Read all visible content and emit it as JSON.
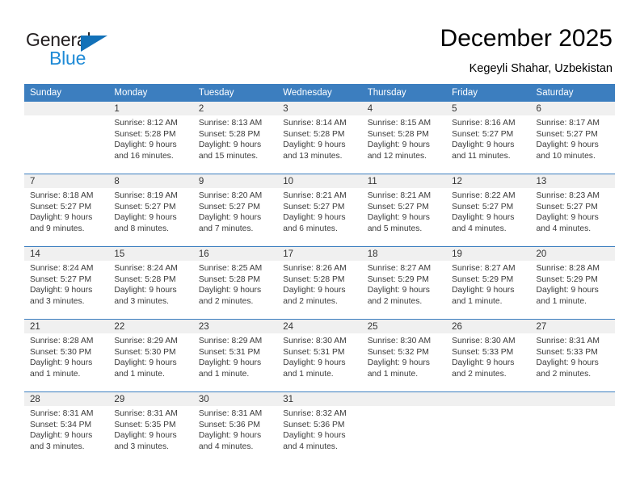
{
  "brand": {
    "name_top": "General",
    "name_bottom": "Blue",
    "triangle_color": "#1271b8",
    "blue_color": "#1e8ad6"
  },
  "header": {
    "title": "December 2025",
    "subtitle": "Kegeyli Shahar, Uzbekistan"
  },
  "theme": {
    "header_blue": "#3c7ebf",
    "daynum_band": "#f0f0f0",
    "text": "#3a3a3a"
  },
  "weekdays": [
    "Sunday",
    "Monday",
    "Tuesday",
    "Wednesday",
    "Thursday",
    "Friday",
    "Saturday"
  ],
  "weeks": [
    [
      {
        "day": "",
        "lines": []
      },
      {
        "day": "1",
        "lines": [
          "Sunrise: 8:12 AM",
          "Sunset: 5:28 PM",
          "Daylight: 9 hours",
          "and 16 minutes."
        ]
      },
      {
        "day": "2",
        "lines": [
          "Sunrise: 8:13 AM",
          "Sunset: 5:28 PM",
          "Daylight: 9 hours",
          "and 15 minutes."
        ]
      },
      {
        "day": "3",
        "lines": [
          "Sunrise: 8:14 AM",
          "Sunset: 5:28 PM",
          "Daylight: 9 hours",
          "and 13 minutes."
        ]
      },
      {
        "day": "4",
        "lines": [
          "Sunrise: 8:15 AM",
          "Sunset: 5:28 PM",
          "Daylight: 9 hours",
          "and 12 minutes."
        ]
      },
      {
        "day": "5",
        "lines": [
          "Sunrise: 8:16 AM",
          "Sunset: 5:27 PM",
          "Daylight: 9 hours",
          "and 11 minutes."
        ]
      },
      {
        "day": "6",
        "lines": [
          "Sunrise: 8:17 AM",
          "Sunset: 5:27 PM",
          "Daylight: 9 hours",
          "and 10 minutes."
        ]
      }
    ],
    [
      {
        "day": "7",
        "lines": [
          "Sunrise: 8:18 AM",
          "Sunset: 5:27 PM",
          "Daylight: 9 hours",
          "and 9 minutes."
        ]
      },
      {
        "day": "8",
        "lines": [
          "Sunrise: 8:19 AM",
          "Sunset: 5:27 PM",
          "Daylight: 9 hours",
          "and 8 minutes."
        ]
      },
      {
        "day": "9",
        "lines": [
          "Sunrise: 8:20 AM",
          "Sunset: 5:27 PM",
          "Daylight: 9 hours",
          "and 7 minutes."
        ]
      },
      {
        "day": "10",
        "lines": [
          "Sunrise: 8:21 AM",
          "Sunset: 5:27 PM",
          "Daylight: 9 hours",
          "and 6 minutes."
        ]
      },
      {
        "day": "11",
        "lines": [
          "Sunrise: 8:21 AM",
          "Sunset: 5:27 PM",
          "Daylight: 9 hours",
          "and 5 minutes."
        ]
      },
      {
        "day": "12",
        "lines": [
          "Sunrise: 8:22 AM",
          "Sunset: 5:27 PM",
          "Daylight: 9 hours",
          "and 4 minutes."
        ]
      },
      {
        "day": "13",
        "lines": [
          "Sunrise: 8:23 AM",
          "Sunset: 5:27 PM",
          "Daylight: 9 hours",
          "and 4 minutes."
        ]
      }
    ],
    [
      {
        "day": "14",
        "lines": [
          "Sunrise: 8:24 AM",
          "Sunset: 5:27 PM",
          "Daylight: 9 hours",
          "and 3 minutes."
        ]
      },
      {
        "day": "15",
        "lines": [
          "Sunrise: 8:24 AM",
          "Sunset: 5:28 PM",
          "Daylight: 9 hours",
          "and 3 minutes."
        ]
      },
      {
        "day": "16",
        "lines": [
          "Sunrise: 8:25 AM",
          "Sunset: 5:28 PM",
          "Daylight: 9 hours",
          "and 2 minutes."
        ]
      },
      {
        "day": "17",
        "lines": [
          "Sunrise: 8:26 AM",
          "Sunset: 5:28 PM",
          "Daylight: 9 hours",
          "and 2 minutes."
        ]
      },
      {
        "day": "18",
        "lines": [
          "Sunrise: 8:27 AM",
          "Sunset: 5:29 PM",
          "Daylight: 9 hours",
          "and 2 minutes."
        ]
      },
      {
        "day": "19",
        "lines": [
          "Sunrise: 8:27 AM",
          "Sunset: 5:29 PM",
          "Daylight: 9 hours",
          "and 1 minute."
        ]
      },
      {
        "day": "20",
        "lines": [
          "Sunrise: 8:28 AM",
          "Sunset: 5:29 PM",
          "Daylight: 9 hours",
          "and 1 minute."
        ]
      }
    ],
    [
      {
        "day": "21",
        "lines": [
          "Sunrise: 8:28 AM",
          "Sunset: 5:30 PM",
          "Daylight: 9 hours",
          "and 1 minute."
        ]
      },
      {
        "day": "22",
        "lines": [
          "Sunrise: 8:29 AM",
          "Sunset: 5:30 PM",
          "Daylight: 9 hours",
          "and 1 minute."
        ]
      },
      {
        "day": "23",
        "lines": [
          "Sunrise: 8:29 AM",
          "Sunset: 5:31 PM",
          "Daylight: 9 hours",
          "and 1 minute."
        ]
      },
      {
        "day": "24",
        "lines": [
          "Sunrise: 8:30 AM",
          "Sunset: 5:31 PM",
          "Daylight: 9 hours",
          "and 1 minute."
        ]
      },
      {
        "day": "25",
        "lines": [
          "Sunrise: 8:30 AM",
          "Sunset: 5:32 PM",
          "Daylight: 9 hours",
          "and 1 minute."
        ]
      },
      {
        "day": "26",
        "lines": [
          "Sunrise: 8:30 AM",
          "Sunset: 5:33 PM",
          "Daylight: 9 hours",
          "and 2 minutes."
        ]
      },
      {
        "day": "27",
        "lines": [
          "Sunrise: 8:31 AM",
          "Sunset: 5:33 PM",
          "Daylight: 9 hours",
          "and 2 minutes."
        ]
      }
    ],
    [
      {
        "day": "28",
        "lines": [
          "Sunrise: 8:31 AM",
          "Sunset: 5:34 PM",
          "Daylight: 9 hours",
          "and 3 minutes."
        ]
      },
      {
        "day": "29",
        "lines": [
          "Sunrise: 8:31 AM",
          "Sunset: 5:35 PM",
          "Daylight: 9 hours",
          "and 3 minutes."
        ]
      },
      {
        "day": "30",
        "lines": [
          "Sunrise: 8:31 AM",
          "Sunset: 5:36 PM",
          "Daylight: 9 hours",
          "and 4 minutes."
        ]
      },
      {
        "day": "31",
        "lines": [
          "Sunrise: 8:32 AM",
          "Sunset: 5:36 PM",
          "Daylight: 9 hours",
          "and 4 minutes."
        ]
      },
      {
        "day": "",
        "lines": []
      },
      {
        "day": "",
        "lines": []
      },
      {
        "day": "",
        "lines": []
      }
    ]
  ]
}
